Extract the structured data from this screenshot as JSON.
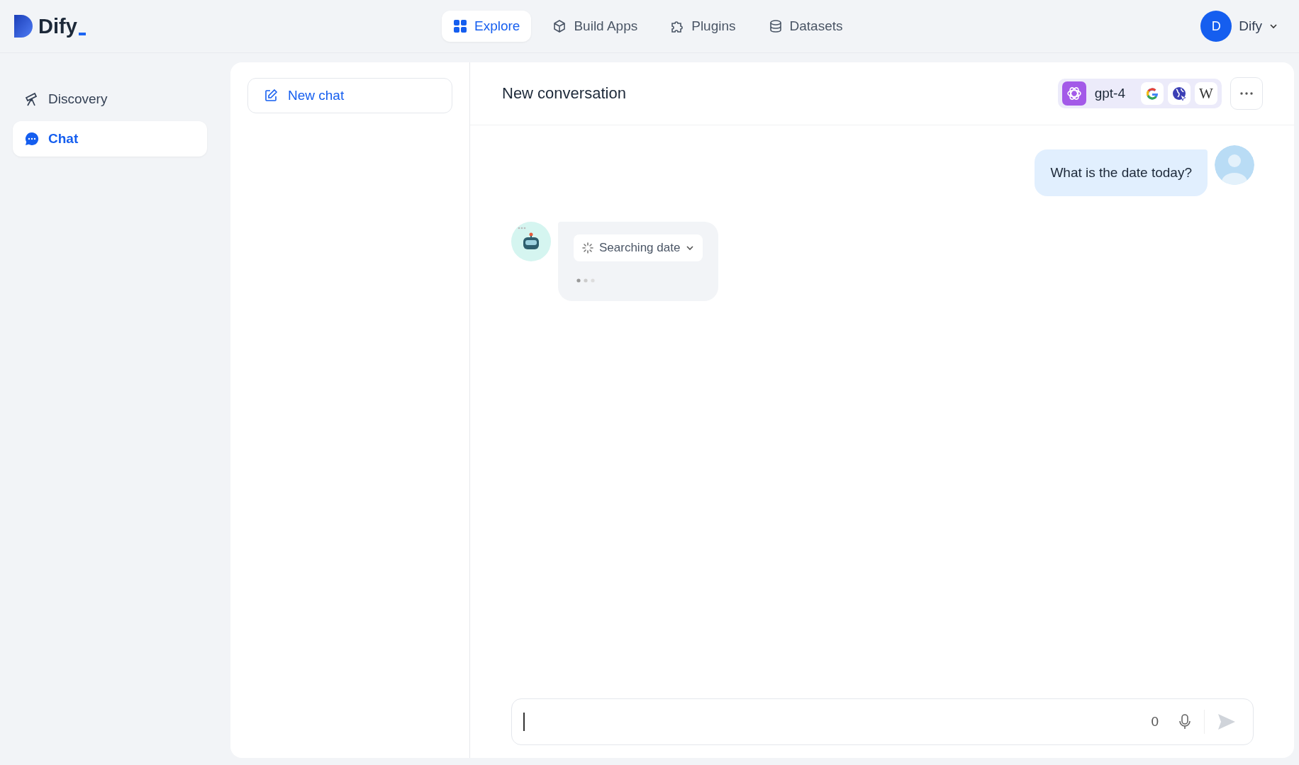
{
  "logo": {
    "text": "Dify"
  },
  "nav": [
    {
      "label": "Explore",
      "kind": "grid",
      "selected": true
    },
    {
      "label": "Build Apps",
      "kind": "cube",
      "selected": false
    },
    {
      "label": "Plugins",
      "kind": "puzzle",
      "selected": false
    },
    {
      "label": "Datasets",
      "kind": "database",
      "selected": false
    }
  ],
  "user": {
    "initial": "D",
    "name": "Dify"
  },
  "sidebar": {
    "items": [
      {
        "label": "Discovery",
        "kind": "telescope",
        "selected": false
      },
      {
        "label": "Chat",
        "kind": "chat",
        "selected": true
      }
    ]
  },
  "new_chat": {
    "label": "New chat"
  },
  "conversation": {
    "title": "New conversation",
    "model": "gpt-4",
    "tools": [
      {
        "kind": "google"
      },
      {
        "kind": "globe"
      },
      {
        "kind": "wiki",
        "label": "W"
      }
    ],
    "messages": [
      {
        "kind": "user",
        "text": "What is the date today?"
      },
      {
        "kind": "assistant",
        "tool_call": {
          "label": "Searching date",
          "loading": true
        },
        "typing": true
      }
    ],
    "input": {
      "char_count": "0"
    }
  }
}
